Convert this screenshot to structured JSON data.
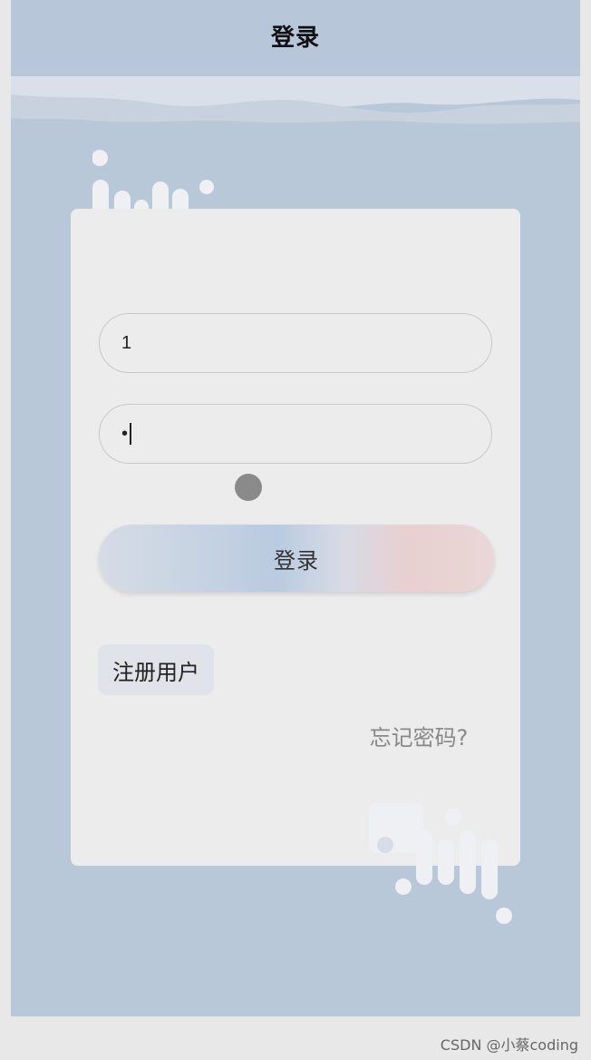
{
  "header": {
    "title": "登录"
  },
  "login_form": {
    "username_value": "1",
    "password_value": "•",
    "submit_label": "登录",
    "register_label": "注册用户",
    "forgot_label": "忘记密码?"
  },
  "watermark": "CSDN @小蔡coding",
  "colors": {
    "background": "#b9c8d9",
    "card": "#ececec",
    "decor": "#eef0f3"
  }
}
